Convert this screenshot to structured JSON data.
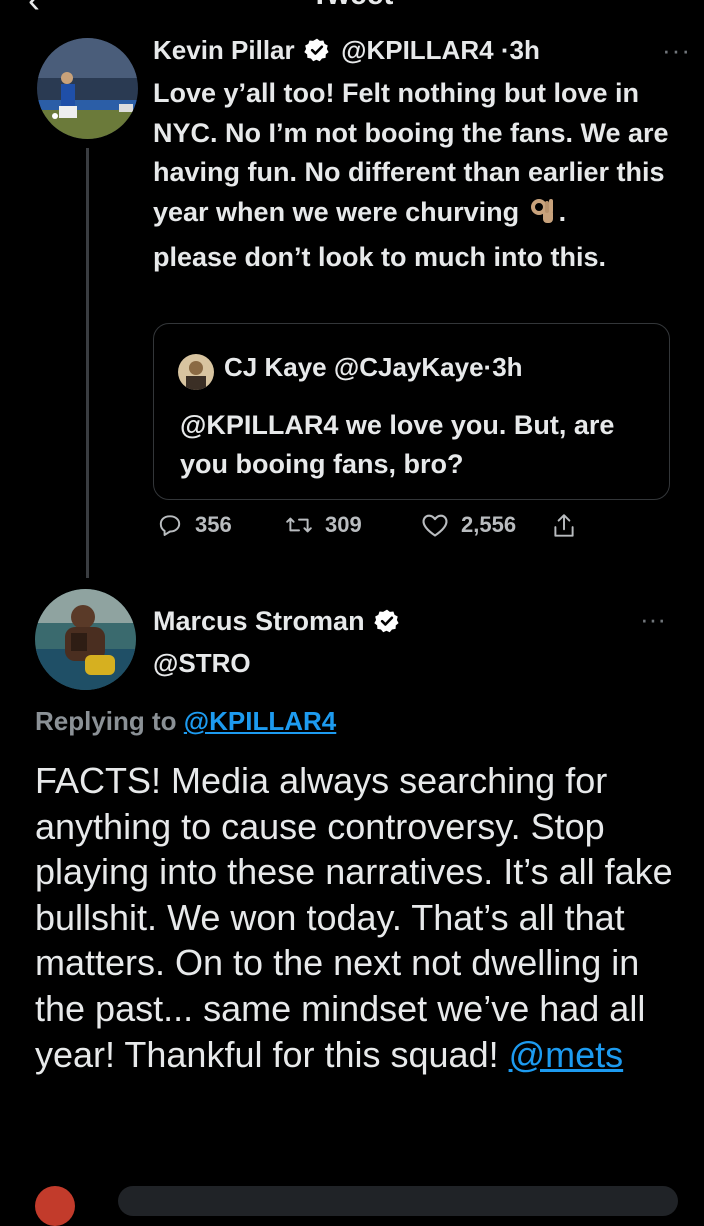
{
  "header": {
    "title": "Tweet",
    "back_icon": "back-arrow-icon"
  },
  "tweet": {
    "author_name": "Kevin Pillar",
    "handle": "@KPILLAR4",
    "separator": "·",
    "time": "3h",
    "more_label": "···",
    "text_part1": "Love y’all too! Felt nothing but love in NYC. No I’m not booing the fans. We are having fun. No different than earlier this year when we were churving ",
    "text_part2": ".",
    "text_part3": "please don’t look to much into this.",
    "quoted": {
      "author_name": "CJ Kaye",
      "handle": "@CJayKaye",
      "separator": "·",
      "time": "3h",
      "text": "@KPILLAR4 we love you. But, are you booing fans, bro?"
    },
    "actions": {
      "replies": "356",
      "retweets": "309",
      "likes": "2,556"
    }
  },
  "reply": {
    "author_name": "Marcus Stroman",
    "handle": "@STRO",
    "more_label": "···",
    "replying_prefix": "Replying to",
    "replying_to": "@KPILLAR4",
    "text": "FACTS! Media always searching for anything to cause controversy. Stop playing into these narratives. It’s all fake bullshit. We won today. That’s all that matters. On to the next not dwelling in the past... same mindset we’ve had all year! Thankful for this squad! ",
    "mention": "@mets"
  },
  "colors": {
    "background": "#000000",
    "text": "#e7e9ea",
    "link": "#1d9bf0",
    "muted": "#71767b",
    "border": "#333639"
  }
}
